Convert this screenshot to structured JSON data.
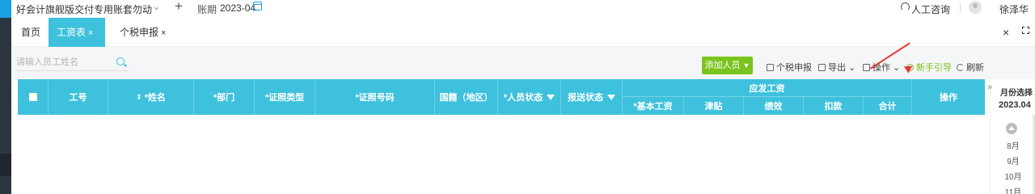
{
  "topbar": {
    "account_name": "好会计旗舰版交付专用账套勿动",
    "add_symbol": "+",
    "period_label": "账期",
    "period_value": "2023-04",
    "consult_label": "人工咨询",
    "user_name": "徐泽华"
  },
  "tabs": [
    {
      "label": "首页",
      "closable": false,
      "active": false
    },
    {
      "label": "工资表",
      "closable": true,
      "active": true
    },
    {
      "label": "个税申报",
      "closable": true,
      "active": false
    }
  ],
  "tab_close_symbol": "×",
  "search": {
    "placeholder": "请输入员工姓名"
  },
  "toolbar": {
    "add_staff": "添加人员",
    "tax_declare": "个税申报",
    "export": "导出",
    "operate": "操作",
    "guide": "新手引导",
    "refresh": "刷新"
  },
  "table": {
    "columns": {
      "emp_no": "工号",
      "name": "*姓名",
      "dept": "*部门",
      "id_type": "*证照类型",
      "id_no": "*证照号码",
      "nationality": "国籍（地区）",
      "staff_status": "*人员状态",
      "submit_status": "报送状态",
      "payable_group": "应发工资",
      "base_salary": "*基本工资",
      "allowance": "津贴",
      "performance": "绩效",
      "deduction": "扣款",
      "total": "合计",
      "operation": "操作"
    },
    "rows": []
  },
  "month_panel": {
    "title": "月份选择",
    "current": "2023.04",
    "months": [
      "8月",
      "9月",
      "10月",
      "11月"
    ]
  },
  "colors": {
    "accent": "#3ec1dd",
    "green": "#7ac41e",
    "annotation": "#e53935"
  }
}
